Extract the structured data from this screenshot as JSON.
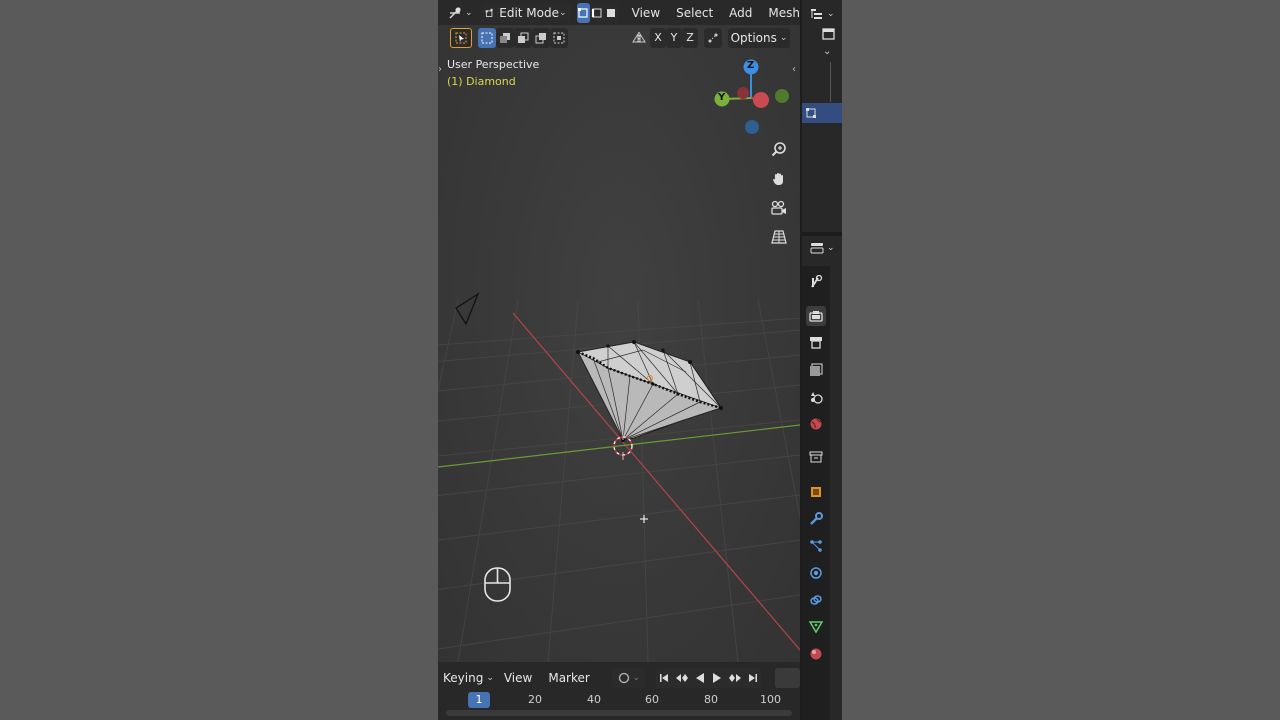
{
  "header": {
    "mode_label": "Edit Mode",
    "menus": [
      "View",
      "Select",
      "Add",
      "Mesh"
    ],
    "axes": [
      "X",
      "Y",
      "Z"
    ],
    "options_label": "Options"
  },
  "viewport": {
    "perspective_label": "User Perspective",
    "object_label": "(1) Diamond"
  },
  "gizmo": {
    "z": "Z",
    "y": "Y"
  },
  "timeline": {
    "keying_label": "Keying",
    "view_label": "View",
    "marker_label": "Marker",
    "current_frame": "1",
    "frame_labels": [
      "20",
      "40",
      "60",
      "80",
      "100"
    ]
  },
  "colors": {
    "selection_blue": "#4772b3",
    "object_label_yellow": "#d8d84a",
    "x_axis_red": "#c94a50",
    "y_axis_green": "#7ab03c",
    "z_axis_blue": "#3d8ee0"
  }
}
